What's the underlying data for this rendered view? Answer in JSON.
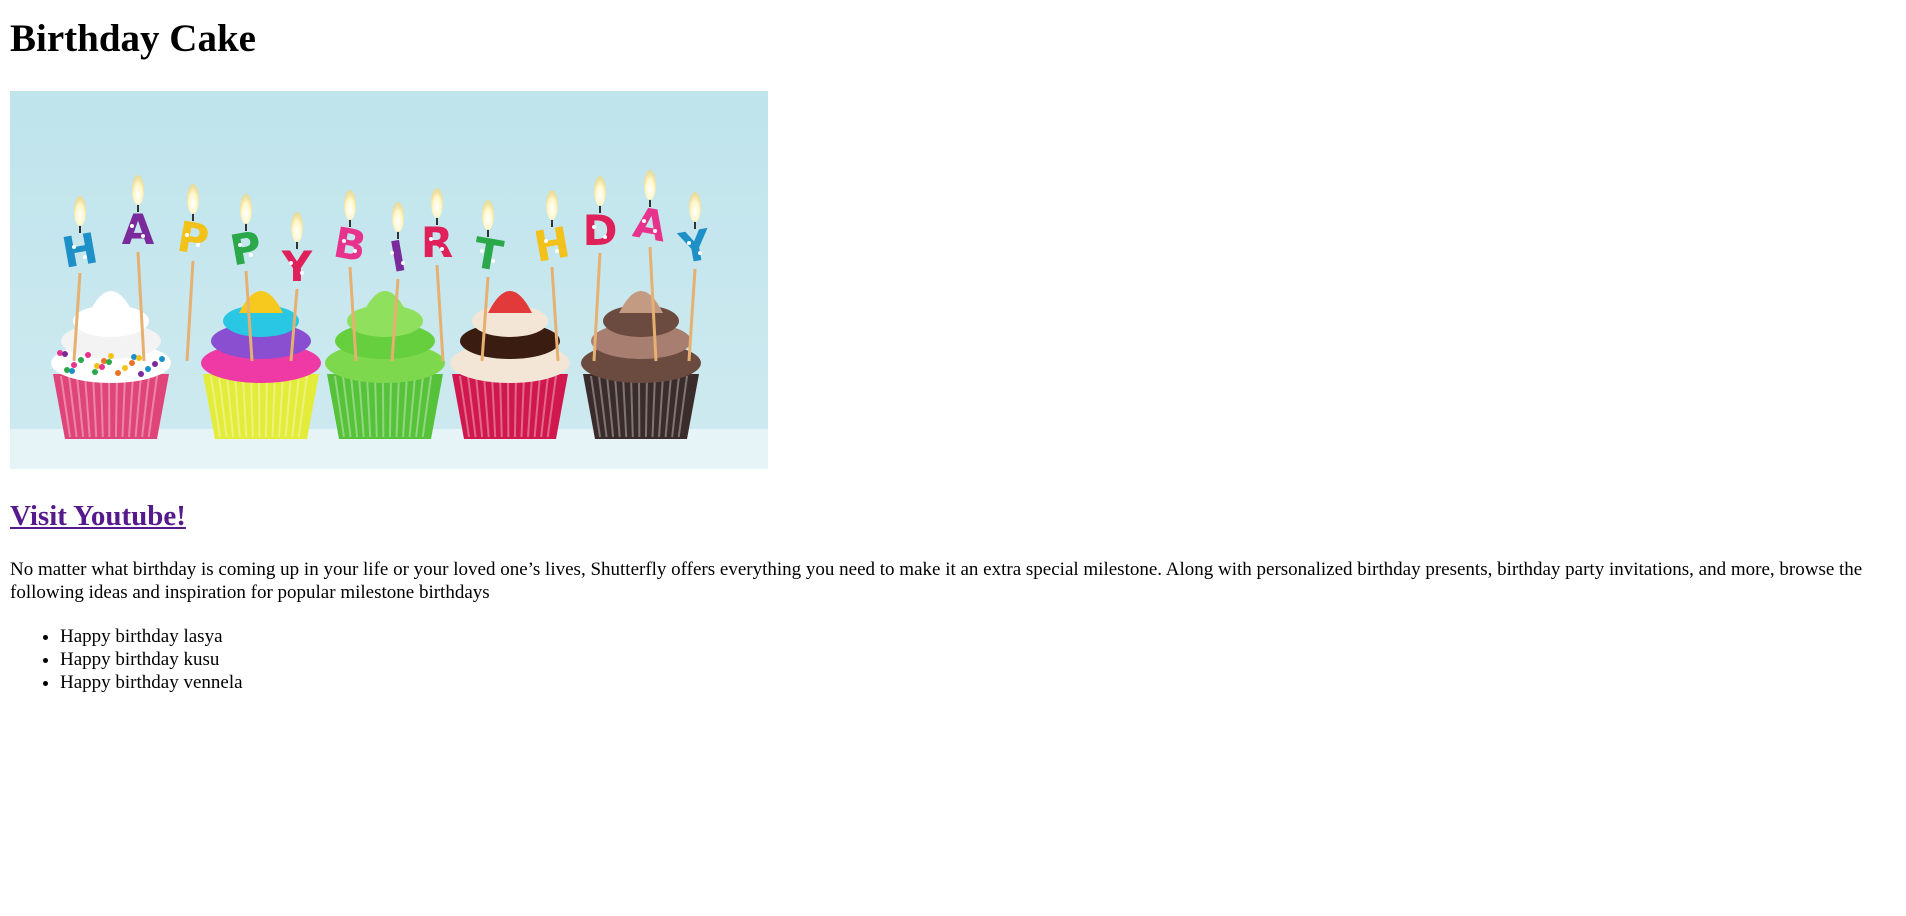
{
  "page": {
    "title": "Birthday Cake"
  },
  "hero_image": {
    "alt": "Happy Birthday cupcakes with letter candles",
    "banner_letters": [
      "H",
      "A",
      "P",
      "P",
      "Y",
      "B",
      "I",
      "R",
      "T",
      "H",
      "D",
      "A",
      "Y"
    ],
    "colors": {
      "background": "#bfe4ec",
      "blue": "#1e90c8",
      "purple": "#7b2a9c",
      "yellow": "#f2c21b",
      "green": "#2aa84a",
      "red": "#e0205a",
      "pink": "#e7338c",
      "orange": "#e87424"
    }
  },
  "link": {
    "label": "Visit Youtube!",
    "color": "#551a8b"
  },
  "intro": {
    "text": "No matter what birthday is coming up in your life or your loved one’s lives, Shutterfly offers everything you need to make it an extra special milestone. Along with personalized birthday presents, birthday party invitations, and more, browse the following ideas and inspiration for popular milestone birthdays"
  },
  "wishes": [
    "Happy birthday lasya",
    "Happy birthday kusu",
    "Happy birthday vennela"
  ]
}
